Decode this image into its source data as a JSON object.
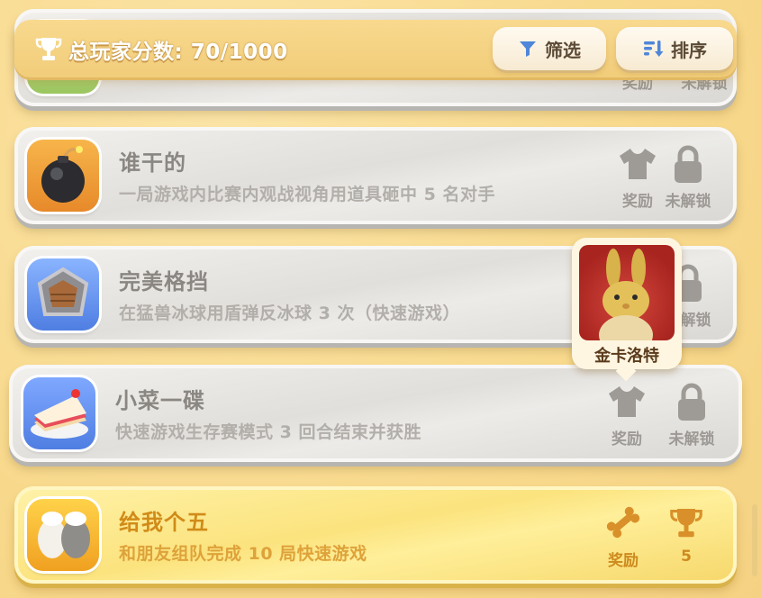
{
  "header": {
    "score_label": "总玩家分数: 70/1000",
    "filter_label": "筛选",
    "sort_label": "排序"
  },
  "achievements": [
    {
      "title": "",
      "description": "",
      "reward_label": "奖励",
      "status_label": "未解锁",
      "state": "locked",
      "icon": "partial-hidden-icon"
    },
    {
      "title": "谁干的",
      "description": "一局游戏内比赛内观战视角用道具砸中 5 名对手",
      "reward_label": "奖励",
      "status_label": "未解锁",
      "state": "locked",
      "icon": "bomb-icon"
    },
    {
      "title": "完美格挡",
      "description": "在猛兽冰球用盾弹反冰球 3 次（快速游戏）",
      "reward_label": "奖励",
      "status_label": "未解锁",
      "state": "locked",
      "icon": "shield-icon"
    },
    {
      "title": "小菜一碟",
      "description": "快速游戏生存赛模式 3 回合结束并获胜",
      "reward_label": "奖励",
      "status_label": "未解锁",
      "state": "locked",
      "icon": "cake-icon"
    },
    {
      "title": "给我个五",
      "description": "和朋友组队完成 10 局快速游戏",
      "reward_label": "奖励",
      "status_label": "5",
      "state": "completed",
      "icon": "high-five-icon"
    }
  ],
  "popup": {
    "name": "金卡洛特"
  },
  "colors": {
    "background": "#f9dd96",
    "card_gray": "#e1dfdb",
    "card_gold": "#fbe37e",
    "accent_gold": "#d18b18"
  }
}
